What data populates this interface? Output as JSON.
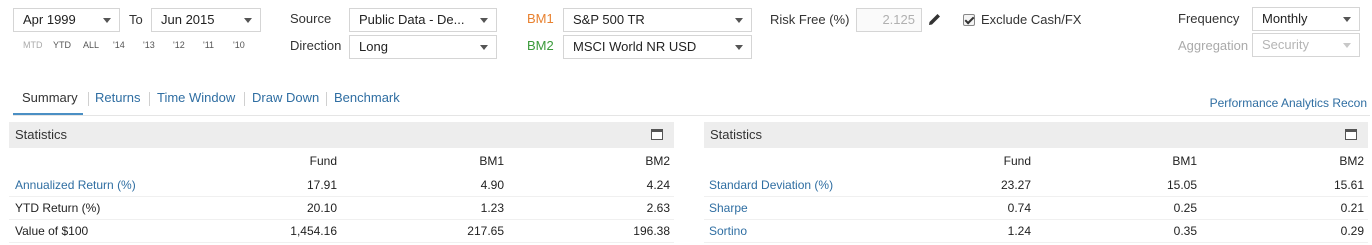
{
  "controls": {
    "start_date": "Apr 1999",
    "to_label": "To",
    "end_date": "Jun 2015",
    "quick_periods": [
      "MTD",
      "YTD",
      "ALL",
      "'14",
      "'13",
      "'12",
      "'11",
      "'10"
    ],
    "source_label": "Source",
    "source_value": "Public Data - De...",
    "direction_label": "Direction",
    "direction_value": "Long",
    "bm1_label": "BM1",
    "bm1_value": "S&P 500 TR",
    "bm2_label": "BM2",
    "bm2_value": "MSCI World NR USD",
    "risk_free_label": "Risk Free (%)",
    "risk_free_value": "2.125",
    "exclude_cash_label": "Exclude Cash/FX",
    "exclude_cash_checked": true,
    "frequency_label": "Frequency",
    "frequency_value": "Monthly",
    "aggregation_label": "Aggregation",
    "aggregation_value": "Security"
  },
  "colors": {
    "bm1": "#e8812f",
    "bm2": "#3a9a3a",
    "link": "#2f6ea2",
    "tab_active_underline": "#4a8fc4"
  },
  "tabs": [
    {
      "label": "Summary",
      "active": true
    },
    {
      "label": "Returns",
      "active": false
    },
    {
      "label": "Time Window",
      "active": false
    },
    {
      "label": "Draw Down",
      "active": false
    },
    {
      "label": "Benchmark",
      "active": false
    }
  ],
  "recon_link": "Performance Analytics Recon",
  "left_panel": {
    "title": "Statistics",
    "headers": [
      "Fund",
      "BM1",
      "BM2"
    ],
    "rows": [
      {
        "label": "Annualized Return (%)",
        "link": true,
        "values": [
          "17.91",
          "4.90",
          "4.24"
        ]
      },
      {
        "label": "YTD Return (%)",
        "link": false,
        "values": [
          "20.10",
          "1.23",
          "2.63"
        ]
      },
      {
        "label": "Value of $100",
        "link": false,
        "values": [
          "1,454.16",
          "217.65",
          "196.38"
        ]
      }
    ]
  },
  "right_panel": {
    "title": "Statistics",
    "headers": [
      "Fund",
      "BM1",
      "BM2"
    ],
    "rows": [
      {
        "label": "Standard Deviation (%)",
        "link": true,
        "values": [
          "23.27",
          "15.05",
          "15.61"
        ]
      },
      {
        "label": "Sharpe",
        "link": true,
        "values": [
          "0.74",
          "0.25",
          "0.21"
        ]
      },
      {
        "label": "Sortino",
        "link": true,
        "values": [
          "1.24",
          "0.35",
          "0.29"
        ]
      }
    ]
  }
}
